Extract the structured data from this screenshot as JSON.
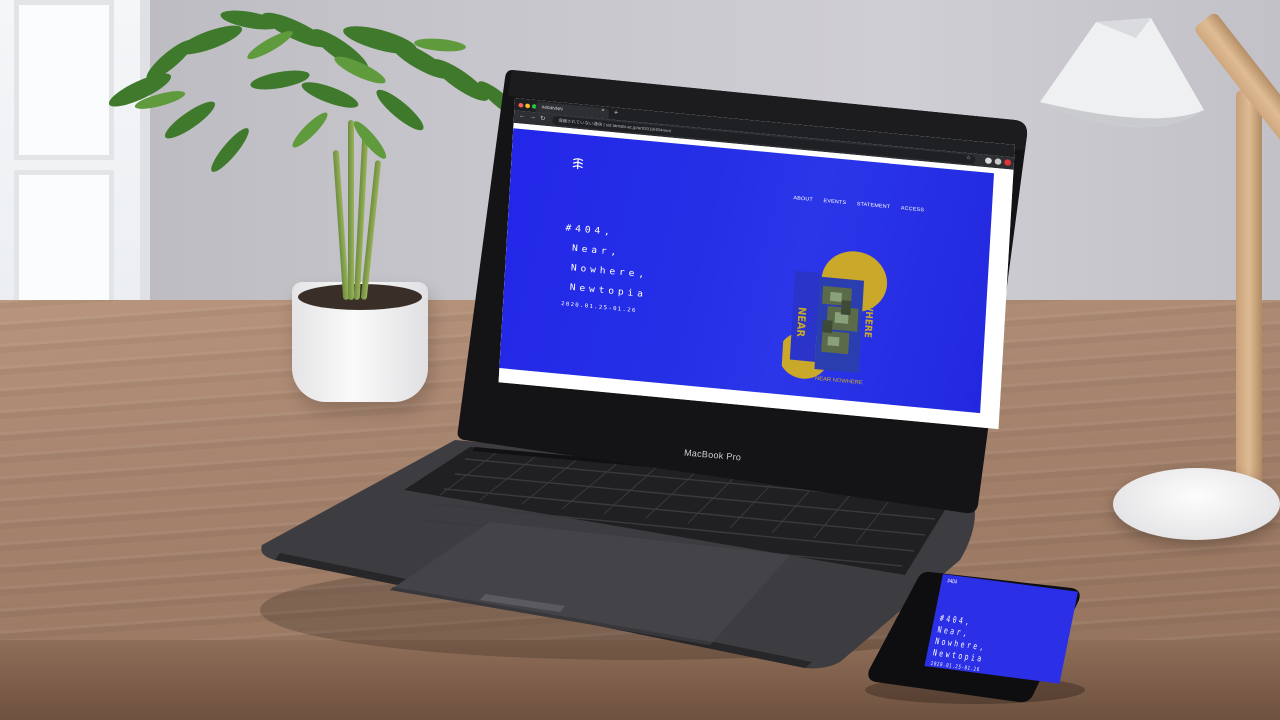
{
  "browser": {
    "tab_title": "#404NNN",
    "tab_close": "×",
    "new_tab": "+",
    "url": "保護されていない通信 | sid.tamabi.ac.jp/art/2019/404nnn/"
  },
  "site": {
    "nav": [
      "ABOUT",
      "EVENTS",
      "STATEMENT",
      "ACCESS"
    ],
    "title_lines": [
      "#404,",
      "Near,",
      "Nowhere,",
      "Newtopia"
    ],
    "dates": "2020.01.25-01.26",
    "artwork_text": "NEAR NOWHERE",
    "colors": {
      "brand_blue": "#2327e8",
      "artwork_yellow": "#c9a82a",
      "browser_dark": "#2d2f33"
    }
  },
  "laptop": {
    "brand": "MacBook Pro"
  },
  "phone": {
    "logo": "#404",
    "title_lines": [
      "#404,",
      "Near,",
      "Nowhere,",
      "Newtopia"
    ],
    "dates": "2020.01.25-01.26"
  }
}
